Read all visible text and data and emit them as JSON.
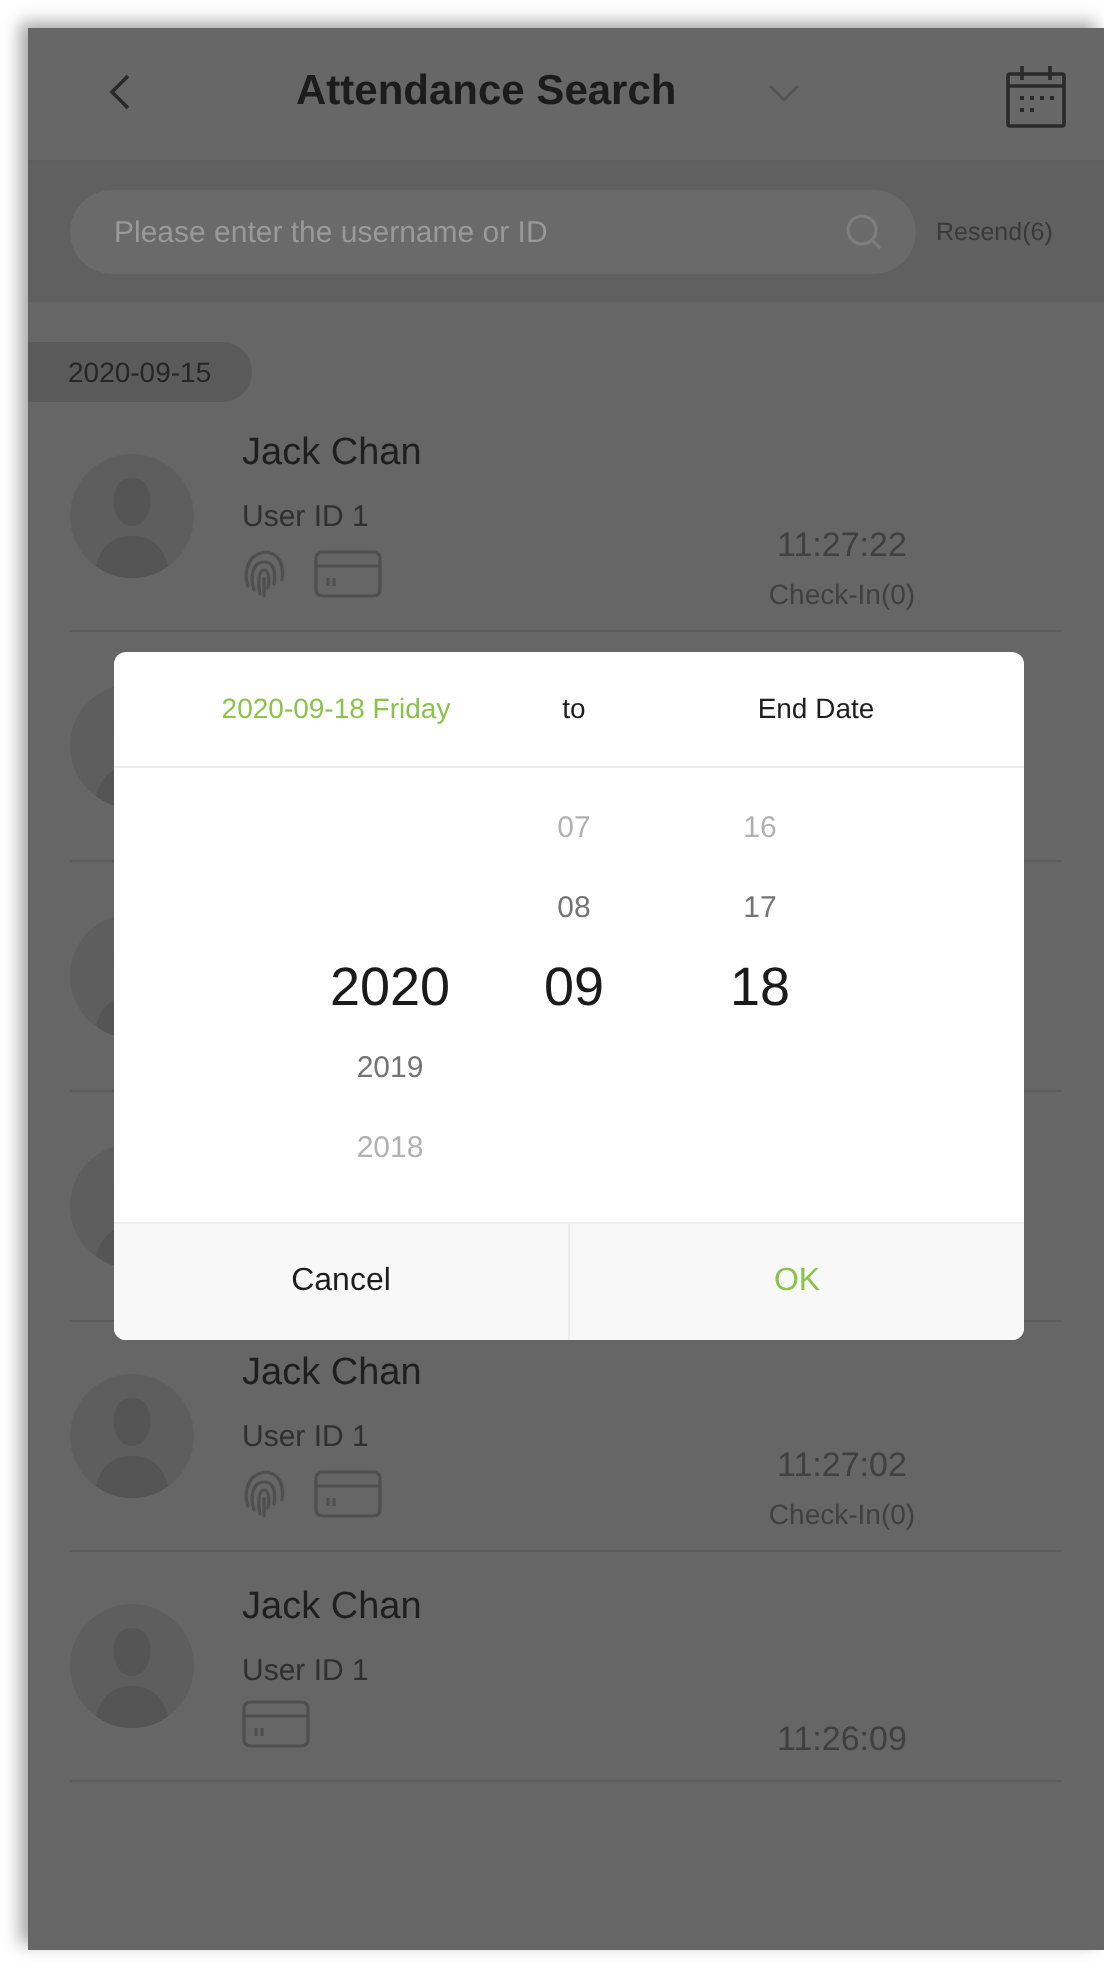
{
  "header": {
    "title": "Attendance Search"
  },
  "search": {
    "placeholder": "Please enter the username or ID",
    "resend": "Resend(6)"
  },
  "date_tag": "2020-09-15",
  "records": [
    {
      "kind": "entry",
      "name": "Jack Chan",
      "user_id": "User ID 1",
      "methods": [
        {
          "kind": "fingerprint"
        },
        {
          "kind": "card"
        }
      ],
      "time": "11:27:22",
      "status": "Check-In(0)"
    },
    {
      "kind": "covered"
    },
    {
      "kind": "covered"
    },
    {
      "kind": "covered"
    },
    {
      "kind": "entry",
      "name": "Jack Chan",
      "user_id": "User ID 1",
      "methods": [
        {
          "kind": "fingerprint"
        },
        {
          "kind": "card"
        }
      ],
      "time": "11:27:02",
      "status": "Check-In(0)"
    },
    {
      "kind": "entry",
      "name": "Jack Chan",
      "user_id": "User ID 1",
      "methods": [
        {
          "kind": "card"
        }
      ],
      "time": "11:26:09"
    }
  ],
  "dialog": {
    "start_date": "2020-09-18 Friday",
    "separator": "to",
    "end_label": "End Date",
    "columns": [
      {
        "items": [
          {
            "text": "2020",
            "selected": true
          },
          {
            "text": "2019",
            "selected": false
          },
          {
            "text": "2018",
            "selected": false
          }
        ]
      },
      {
        "items": [
          {
            "text": "07",
            "selected": false
          },
          {
            "text": "08",
            "selected": false
          },
          {
            "text": "09",
            "selected": true
          }
        ]
      },
      {
        "items": [
          {
            "text": "16",
            "selected": false
          },
          {
            "text": "17",
            "selected": false
          },
          {
            "text": "18",
            "selected": true
          }
        ]
      }
    ],
    "cancel": "Cancel",
    "ok": "OK"
  }
}
